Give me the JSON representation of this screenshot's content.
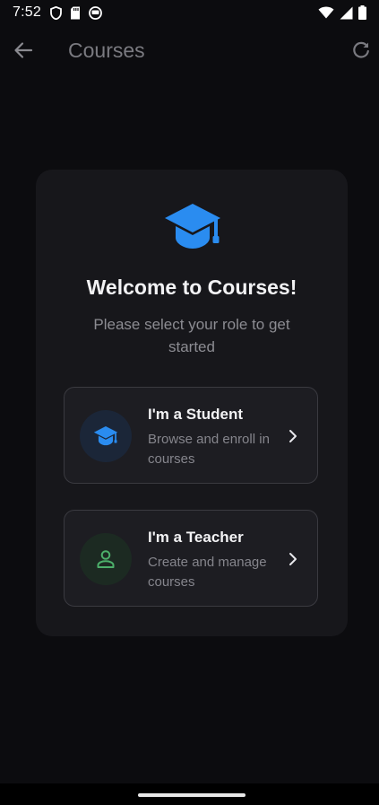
{
  "status_bar": {
    "time": "7:52"
  },
  "app_bar": {
    "title": "Courses"
  },
  "welcome_card": {
    "heading": "Welcome to Courses!",
    "subtitle": "Please select your role to get started"
  },
  "roles": [
    {
      "title": "I'm a Student",
      "description": "Browse and enroll in courses",
      "icon": "graduation-cap-icon",
      "accent": "#2a8cf0"
    },
    {
      "title": "I'm a Teacher",
      "description": "Create and manage courses",
      "icon": "person-icon",
      "accent": "#4caf6a"
    }
  ],
  "colors": {
    "background": "#0c0c0f",
    "card": "#17171b",
    "brand_blue": "#2a8cf0",
    "teacher_green": "#4caf6a"
  }
}
